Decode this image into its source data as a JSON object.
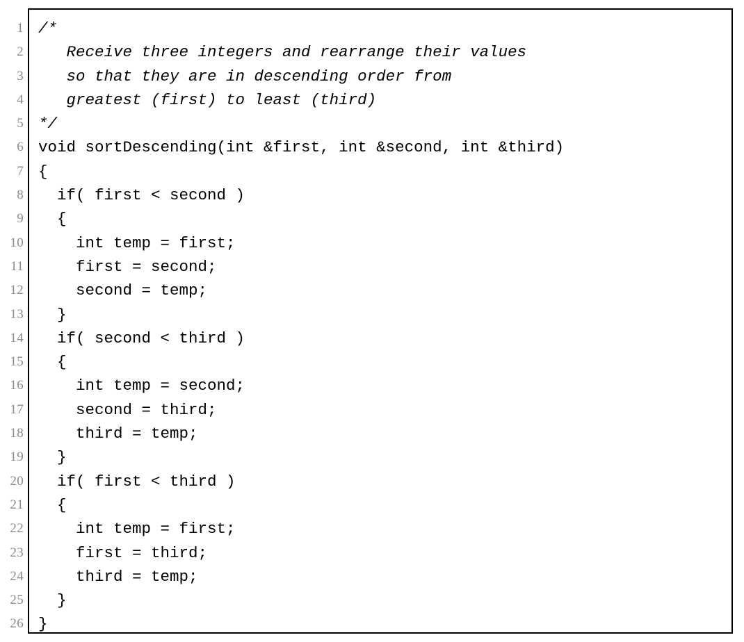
{
  "listing": {
    "language": "C++",
    "first_line_number": 1,
    "last_line_number": 26,
    "line_number_color": "#8a8a8a",
    "code_color": "#000000",
    "frame_color": "#000000",
    "background_color": "#ffffff",
    "lines": [
      {
        "number": "1",
        "text": "/*",
        "style": "comment"
      },
      {
        "number": "2",
        "text": "   Receive three integers and rearrange their values",
        "style": "comment"
      },
      {
        "number": "3",
        "text": "   so that they are in descending order from",
        "style": "comment"
      },
      {
        "number": "4",
        "text": "   greatest (first) to least (third)",
        "style": "comment"
      },
      {
        "number": "5",
        "text": "*/",
        "style": "comment"
      },
      {
        "number": "6",
        "text": "void sortDescending(int &first, int &second, int &third)",
        "style": "code"
      },
      {
        "number": "7",
        "text": "{",
        "style": "code"
      },
      {
        "number": "8",
        "text": "  if( first < second )",
        "style": "code"
      },
      {
        "number": "9",
        "text": "  {",
        "style": "code"
      },
      {
        "number": "10",
        "text": "    int temp = first;",
        "style": "code"
      },
      {
        "number": "11",
        "text": "    first = second;",
        "style": "code"
      },
      {
        "number": "12",
        "text": "    second = temp;",
        "style": "code"
      },
      {
        "number": "13",
        "text": "  }",
        "style": "code"
      },
      {
        "number": "14",
        "text": "  if( second < third )",
        "style": "code"
      },
      {
        "number": "15",
        "text": "  {",
        "style": "code"
      },
      {
        "number": "16",
        "text": "    int temp = second;",
        "style": "code"
      },
      {
        "number": "17",
        "text": "    second = third;",
        "style": "code"
      },
      {
        "number": "18",
        "text": "    third = temp;",
        "style": "code"
      },
      {
        "number": "19",
        "text": "  }",
        "style": "code"
      },
      {
        "number": "20",
        "text": "  if( first < third )",
        "style": "code"
      },
      {
        "number": "21",
        "text": "  {",
        "style": "code"
      },
      {
        "number": "22",
        "text": "    int temp = first;",
        "style": "code"
      },
      {
        "number": "23",
        "text": "    first = third;",
        "style": "code"
      },
      {
        "number": "24",
        "text": "    third = temp;",
        "style": "code"
      },
      {
        "number": "25",
        "text": "  }",
        "style": "code"
      },
      {
        "number": "26",
        "text": "}",
        "style": "code"
      }
    ]
  }
}
